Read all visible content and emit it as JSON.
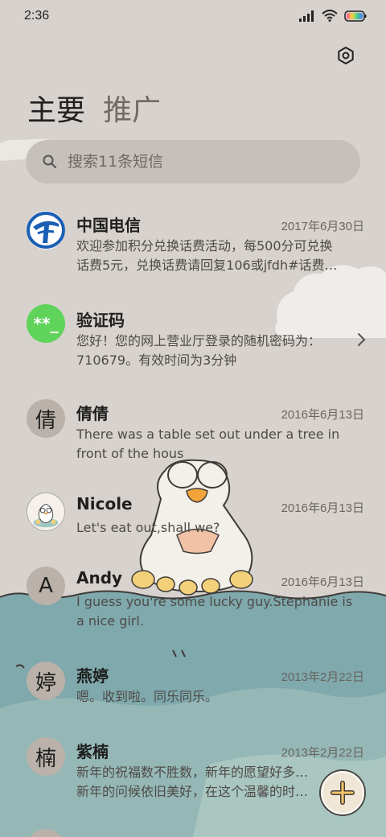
{
  "status_bar": {
    "time": "2:36",
    "icons": [
      "signal-icon",
      "wifi-icon",
      "battery-icon"
    ]
  },
  "header": {
    "settings_icon": "settings-icon",
    "tabs": [
      {
        "label": "主要",
        "active": true
      },
      {
        "label": "推广",
        "active": false
      }
    ]
  },
  "search": {
    "placeholder": "搜索11条短信"
  },
  "conversations": [
    {
      "name": "中国电信",
      "date": "2017年6月30日",
      "preview": [
        "欢迎参加积分兑换话费活动，每500分可兑换",
        "话费5元，兑换话费请回复106或jfdh#话费…"
      ],
      "avatar": "china-telecom-logo"
    },
    {
      "name": "验证码",
      "date": "",
      "preview": [
        "您好！您的网上营业厅登录的随机密码为：",
        "710679。有效时间为3分钟"
      ],
      "avatar": "verification-code-icon",
      "avatar_text": "**_"
    },
    {
      "name": "倩倩",
      "date": "2016年6月13日",
      "preview": [
        "There was a table set out under a tree in",
        "front of the hous"
      ],
      "avatar_text": "倩"
    },
    {
      "name": "Nicole",
      "date": "2016年6月13日",
      "preview": [
        "Let's eat out,shall we?"
      ],
      "avatar": "goose-avatar"
    },
    {
      "name": "Andy",
      "date": "2016年6月13日",
      "preview": [
        "I guess you're some lucky guy.Stephanie is",
        "a nice girl."
      ],
      "avatar_text": "A"
    },
    {
      "name": "燕婷",
      "date": "2013年2月22日",
      "preview": [
        "嗯。收到啦。同乐同乐。"
      ],
      "avatar_text": "婷"
    },
    {
      "name": "紫楠",
      "date": "2013年2月22日",
      "preview": [
        "新年的祝福数不胜数，新年的愿望好多好多，",
        "新年的问候依旧美好，在这个温馨的时刻…"
      ],
      "avatar_text": "楠"
    }
  ],
  "fab": {
    "icon": "plus-icon"
  },
  "colors": {
    "background": "#d7d2cd",
    "water": "#7fa9ad",
    "accent_green": "#5fd35a",
    "telecom_blue": "#1a5fb4"
  }
}
